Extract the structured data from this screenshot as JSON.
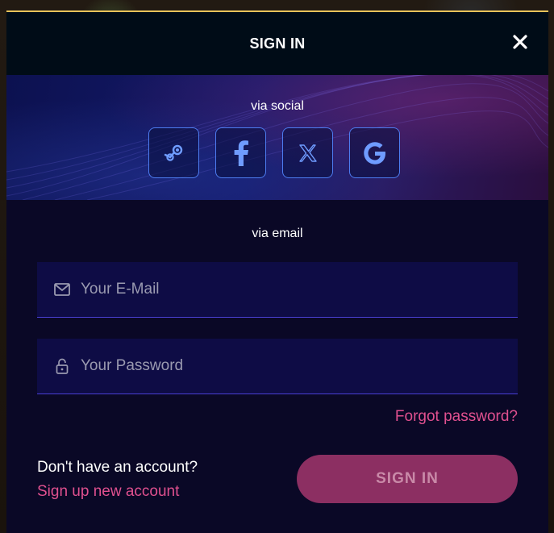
{
  "modal": {
    "title": "SIGN IN",
    "close_icon": "close-icon",
    "accent_border": "#e8c35a"
  },
  "social": {
    "label": "via social",
    "buttons": [
      {
        "icon": "steam-icon",
        "name": "Steam"
      },
      {
        "icon": "facebook-icon",
        "name": "Facebook"
      },
      {
        "icon": "x-icon",
        "name": "X"
      },
      {
        "icon": "google-icon",
        "name": "Google"
      }
    ]
  },
  "email": {
    "label": "via email",
    "email_placeholder": "Your E-Mail",
    "email_value": "",
    "email_icon": "mail-icon",
    "password_placeholder": "Your Password",
    "password_value": "",
    "password_icon": "lock-icon"
  },
  "links": {
    "forgot_password": "Forgot password?",
    "no_account": "Don't have an account?",
    "signup": "Sign up new account"
  },
  "submit": {
    "label": "SIGN IN"
  },
  "colors": {
    "link": "#e0508f",
    "button_bg": "#8c2f62",
    "icon_blue": "#4d7cf0"
  }
}
